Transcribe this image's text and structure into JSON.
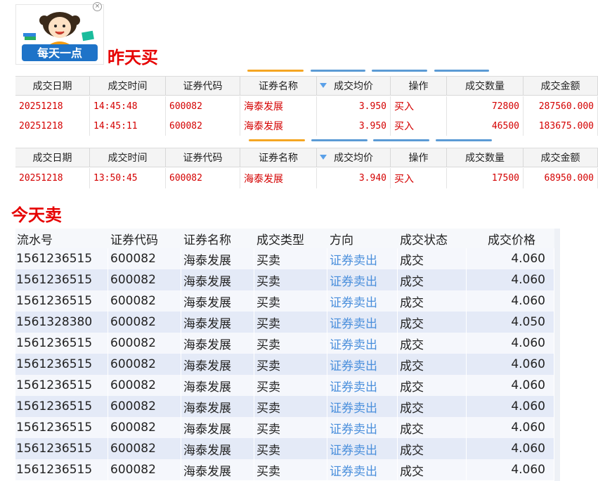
{
  "logo": {
    "text": "每天一点",
    "close_glyph": "×"
  },
  "section_yesterday": {
    "title": "昨天买"
  },
  "section_today": {
    "title": "今天卖"
  },
  "trade_table_headers": [
    "成交日期",
    "成交时间",
    "证券代码",
    "证券名称",
    "成交均价",
    "操作",
    "成交数量",
    "成交金额"
  ],
  "yesterday_table_1": {
    "rows": [
      [
        "20251218",
        "14:45:48",
        "600082",
        "海泰发展",
        "3.950",
        "买入",
        "72800",
        "287560.000"
      ],
      [
        "20251218",
        "14:45:11",
        "600082",
        "海泰发展",
        "3.950",
        "买入",
        "46500",
        "183675.000"
      ]
    ]
  },
  "yesterday_table_2": {
    "rows": [
      [
        "20251218",
        "13:50:45",
        "600082",
        "海泰发展",
        "3.940",
        "买入",
        "17500",
        "68950.000"
      ]
    ]
  },
  "today_table": {
    "headers": [
      "流水号",
      "证券代码",
      "证券名称",
      "成交类型",
      "方向",
      "成交状态",
      "成交价格"
    ],
    "rows": [
      [
        "1561236515",
        "600082",
        "海泰发展",
        "买卖",
        "证券卖出",
        "成交",
        "4.060"
      ],
      [
        "1561236515",
        "600082",
        "海泰发展",
        "买卖",
        "证券卖出",
        "成交",
        "4.060"
      ],
      [
        "1561236515",
        "600082",
        "海泰发展",
        "买卖",
        "证券卖出",
        "成交",
        "4.060"
      ],
      [
        "1561328380",
        "600082",
        "海泰发展",
        "买卖",
        "证券卖出",
        "成交",
        "4.050"
      ],
      [
        "1561236515",
        "600082",
        "海泰发展",
        "买卖",
        "证券卖出",
        "成交",
        "4.060"
      ],
      [
        "1561236515",
        "600082",
        "海泰发展",
        "买卖",
        "证券卖出",
        "成交",
        "4.060"
      ],
      [
        "1561236515",
        "600082",
        "海泰发展",
        "买卖",
        "证券卖出",
        "成交",
        "4.060"
      ],
      [
        "1561236515",
        "600082",
        "海泰发展",
        "买卖",
        "证券卖出",
        "成交",
        "4.060"
      ],
      [
        "1561236515",
        "600082",
        "海泰发展",
        "买卖",
        "证券卖出",
        "成交",
        "4.060"
      ],
      [
        "1561236515",
        "600082",
        "海泰发展",
        "买卖",
        "证券卖出",
        "成交",
        "4.060"
      ],
      [
        "1561236515",
        "600082",
        "海泰发展",
        "买卖",
        "证券卖出",
        "成交",
        "4.060"
      ]
    ]
  },
  "colors": {
    "title_red": "#e60000",
    "trade_red": "#d40000",
    "link_blue": "#4a8fdc",
    "tab_orange": "#f5a623",
    "tab_blue": "#5b9bd5",
    "row_alt": "#e4eaf7"
  },
  "icons": {
    "sort": "sort-desc-triangle-icon",
    "close": "close-icon"
  }
}
